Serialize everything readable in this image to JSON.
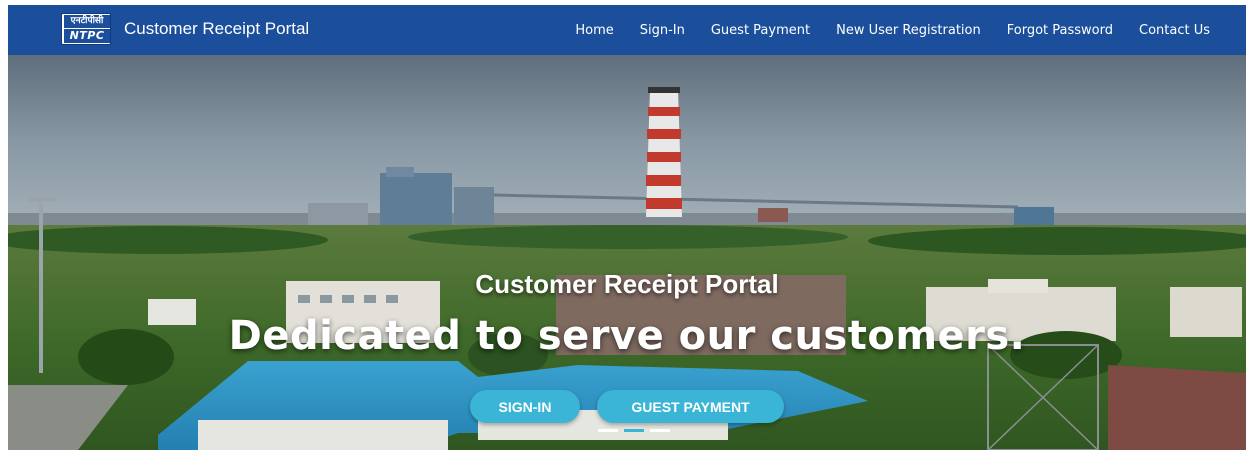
{
  "navbar": {
    "logo": {
      "line1": "एनटीपीसी",
      "line2": "NTPC"
    },
    "brand_title": "Customer Receipt Portal",
    "links": [
      {
        "label": "Home"
      },
      {
        "label": "Sign-In"
      },
      {
        "label": "Guest Payment"
      },
      {
        "label": "New User Registration"
      },
      {
        "label": "Forgot Password"
      },
      {
        "label": "Contact Us"
      }
    ],
    "bg_color": "#1b4f9c"
  },
  "hero": {
    "subtitle": "Customer Receipt Portal",
    "title": "Dedicated to serve our customers.",
    "buttons": {
      "signin": "SIGN-IN",
      "guest_payment": "GUEST PAYMENT"
    },
    "button_color": "#3ab5d6",
    "carousel": {
      "slide_count": 3,
      "active_index": 1
    }
  }
}
